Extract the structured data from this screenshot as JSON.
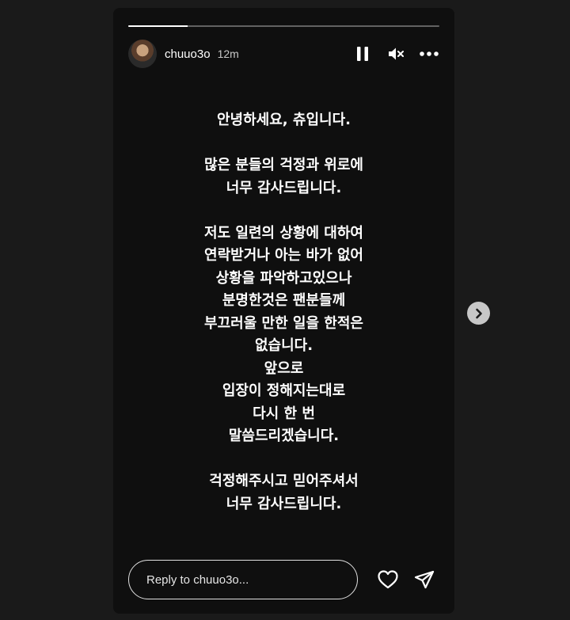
{
  "story": {
    "progress_fraction": 0.19,
    "username": "chuuo3o",
    "time_ago": "12m",
    "icons": {
      "pause": "pause-icon",
      "mute": "muted-speaker-icon",
      "more": "more-options-icon",
      "like": "heart-icon",
      "share": "send-icon",
      "next": "chevron-right-icon"
    },
    "lines": [
      "안녕하세요, 츄입니다.",
      "",
      "많은 분들의 걱정과 위로에",
      "너무 감사드립니다.",
      "",
      "저도 일련의 상황에 대하여",
      "연락받거나 아는 바가 없어",
      "상황을 파악하고있으나",
      "분명한것은 팬분들께",
      "부끄러울 만한 일을 한적은",
      "없습니다.",
      "앞으로",
      "입장이 정해지는대로",
      "다시 한 번",
      "말씀드리겠습니다.",
      "",
      "걱정해주시고 믿어주셔서",
      "너무 감사드립니다."
    ]
  },
  "reply": {
    "placeholder": "Reply to chuuo3o..."
  }
}
